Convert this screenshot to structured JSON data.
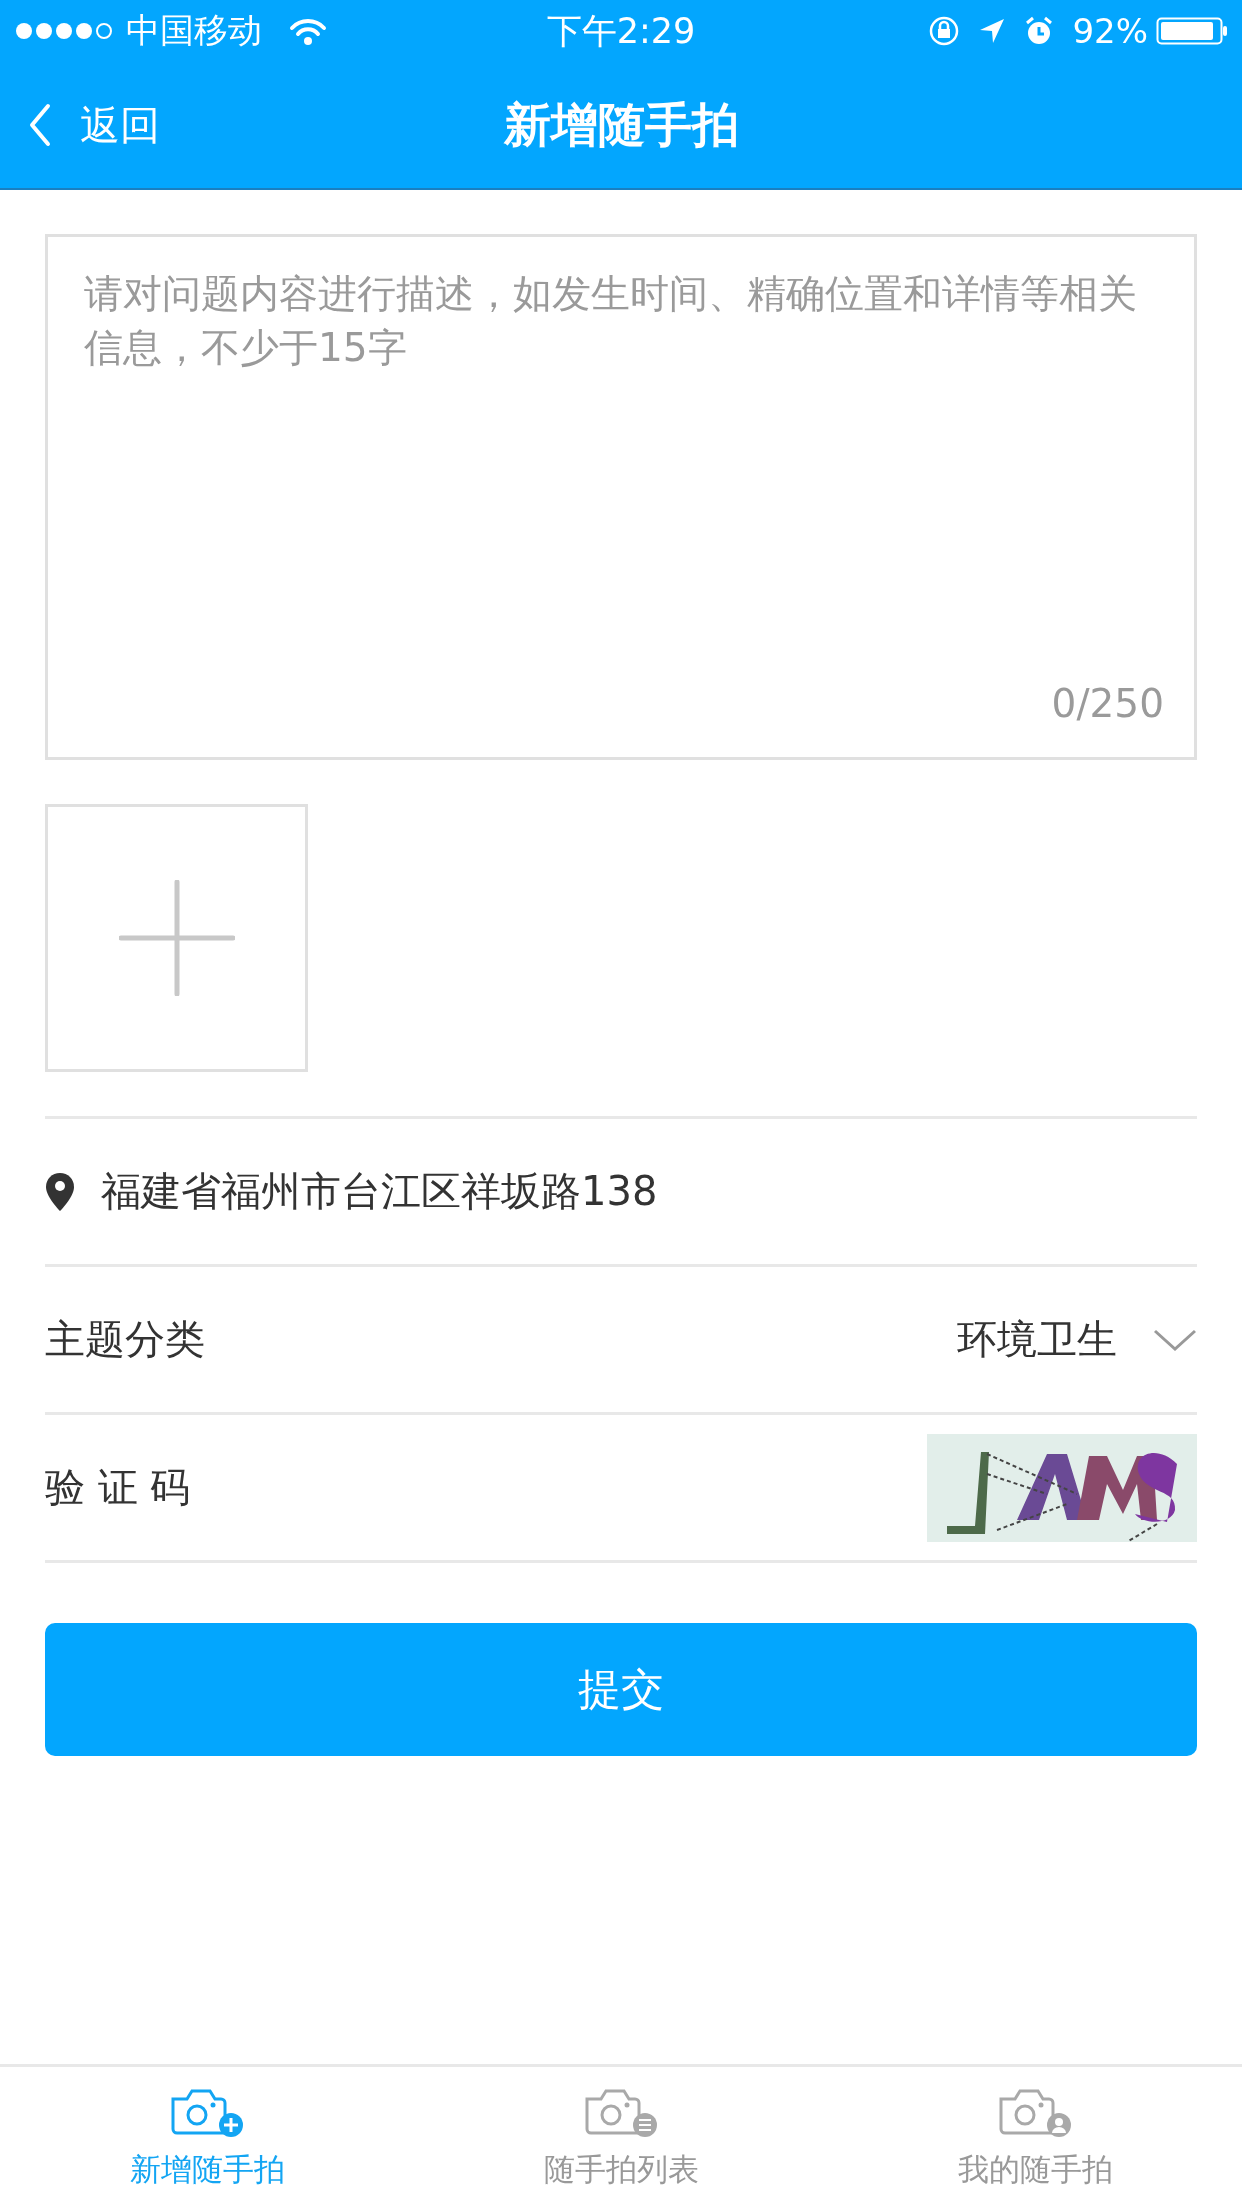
{
  "status_bar": {
    "carrier": "中国移动",
    "time": "下午2:29",
    "battery": "92%"
  },
  "nav": {
    "back": "返回",
    "title": "新增随手拍"
  },
  "description": {
    "placeholder": "请对问题内容进行描述，如发生时间、精确位置和详情等相关信息，不少于15字",
    "counter": "0/250"
  },
  "location": "福建省福州市台江区祥坂路138",
  "fields": [
    {
      "kind": "select",
      "label": "主题分类",
      "value": "环境卫生"
    },
    {
      "kind": "captcha",
      "label": "验 证 码"
    }
  ],
  "submit": "提交",
  "tabs": [
    {
      "label": "新增随手拍",
      "kind": "add",
      "selected": true
    },
    {
      "label": "随手拍列表",
      "kind": "list",
      "selected": false
    },
    {
      "label": "我的随手拍",
      "kind": "user",
      "selected": false
    }
  ]
}
